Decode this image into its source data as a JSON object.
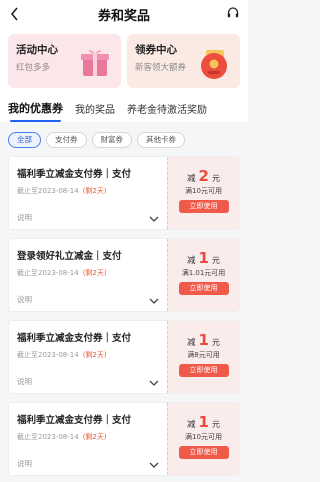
{
  "header": {
    "title": "券和奖品"
  },
  "promos": [
    {
      "title": "活动中心",
      "subtitle": "红包多多"
    },
    {
      "title": "领券中心",
      "subtitle": "新客领大额券"
    }
  ],
  "tabs": [
    {
      "label": "我的优惠券",
      "active": true
    },
    {
      "label": "我的奖品",
      "active": false
    },
    {
      "label": "养老金待激活奖励",
      "active": false
    }
  ],
  "filters": [
    {
      "label": "全部",
      "active": true
    },
    {
      "label": "支付券",
      "active": false
    },
    {
      "label": "财富券",
      "active": false
    },
    {
      "label": "其他卡券",
      "active": false
    }
  ],
  "coupons": [
    {
      "name": "福利季立减金支付券｜支付",
      "expiry": "截止至2023-08-14",
      "remain": "(剩2天)",
      "explain": "说明",
      "prefix": "减",
      "amount": "2",
      "unit": "元",
      "condition": "满10元可用",
      "button": "立即使用"
    },
    {
      "name": "登录领好礼立减金｜支付",
      "expiry": "截止至2023-08-14",
      "remain": "(剩2天)",
      "explain": "说明",
      "prefix": "减",
      "amount": "1",
      "unit": "元",
      "condition": "满1.01元可用",
      "button": "立即使用"
    },
    {
      "name": "福利季立减金支付券｜支付",
      "expiry": "截止至2023-08-14",
      "remain": "(剩2天)",
      "explain": "说明",
      "prefix": "减",
      "amount": "1",
      "unit": "元",
      "condition": "满8元可用",
      "button": "立即使用"
    },
    {
      "name": "福利季立减金支付券｜支付",
      "expiry": "截止至2023-08-14",
      "remain": "(剩2天)",
      "explain": "说明",
      "prefix": "减",
      "amount": "1",
      "unit": "元",
      "condition": "满10元可用",
      "button": "立即使用"
    }
  ],
  "colors": {
    "accent": "#1e64f0",
    "price": "#e94b3c",
    "use_button": "#f05a4a"
  },
  "icons": {
    "back": "chevron-left-icon",
    "service": "headset-icon",
    "gift": "gift-box-icon",
    "envelope": "red-envelope-icon",
    "chevron": "chevron-down-icon"
  }
}
